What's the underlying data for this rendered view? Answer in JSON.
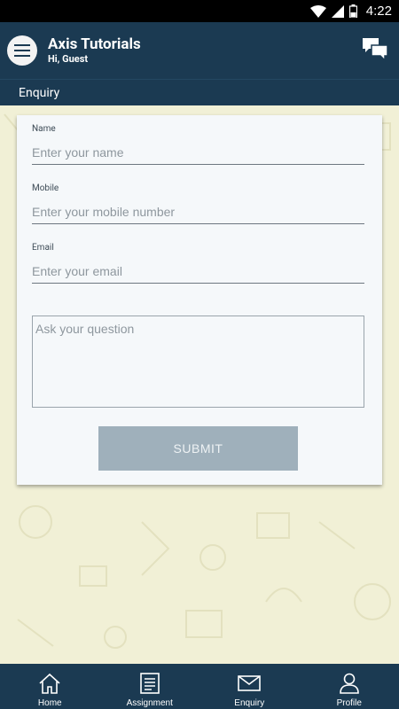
{
  "status_bar": {
    "time": "4:22",
    "icons": [
      "wifi-icon",
      "signal-icon",
      "battery-icon"
    ]
  },
  "app_bar": {
    "title": "Axis Tutorials",
    "subtitle": "Hi, Guest",
    "menu_icon": "menu-icon",
    "chat_icon": "chat-icon"
  },
  "section": {
    "title": "Enquiry"
  },
  "form": {
    "name_label": "Name",
    "name_placeholder": "Enter your name",
    "mobile_label": "Mobile",
    "mobile_placeholder": "Enter your mobile number",
    "email_label": "Email",
    "email_placeholder": "Enter your email",
    "question_placeholder": "Ask your question",
    "submit_label": "SUBMIT"
  },
  "bottom_nav": {
    "items": [
      {
        "label": "Home",
        "icon": "home-icon"
      },
      {
        "label": "Assignment",
        "icon": "assignment-icon"
      },
      {
        "label": "Enquiry",
        "icon": "mail-icon"
      },
      {
        "label": "Profile",
        "icon": "profile-icon"
      }
    ]
  },
  "colors": {
    "primary": "#1b3a52",
    "background": "#f1f0d6",
    "card": "#f5f8fa",
    "button_disabled": "#9fb0bb"
  }
}
